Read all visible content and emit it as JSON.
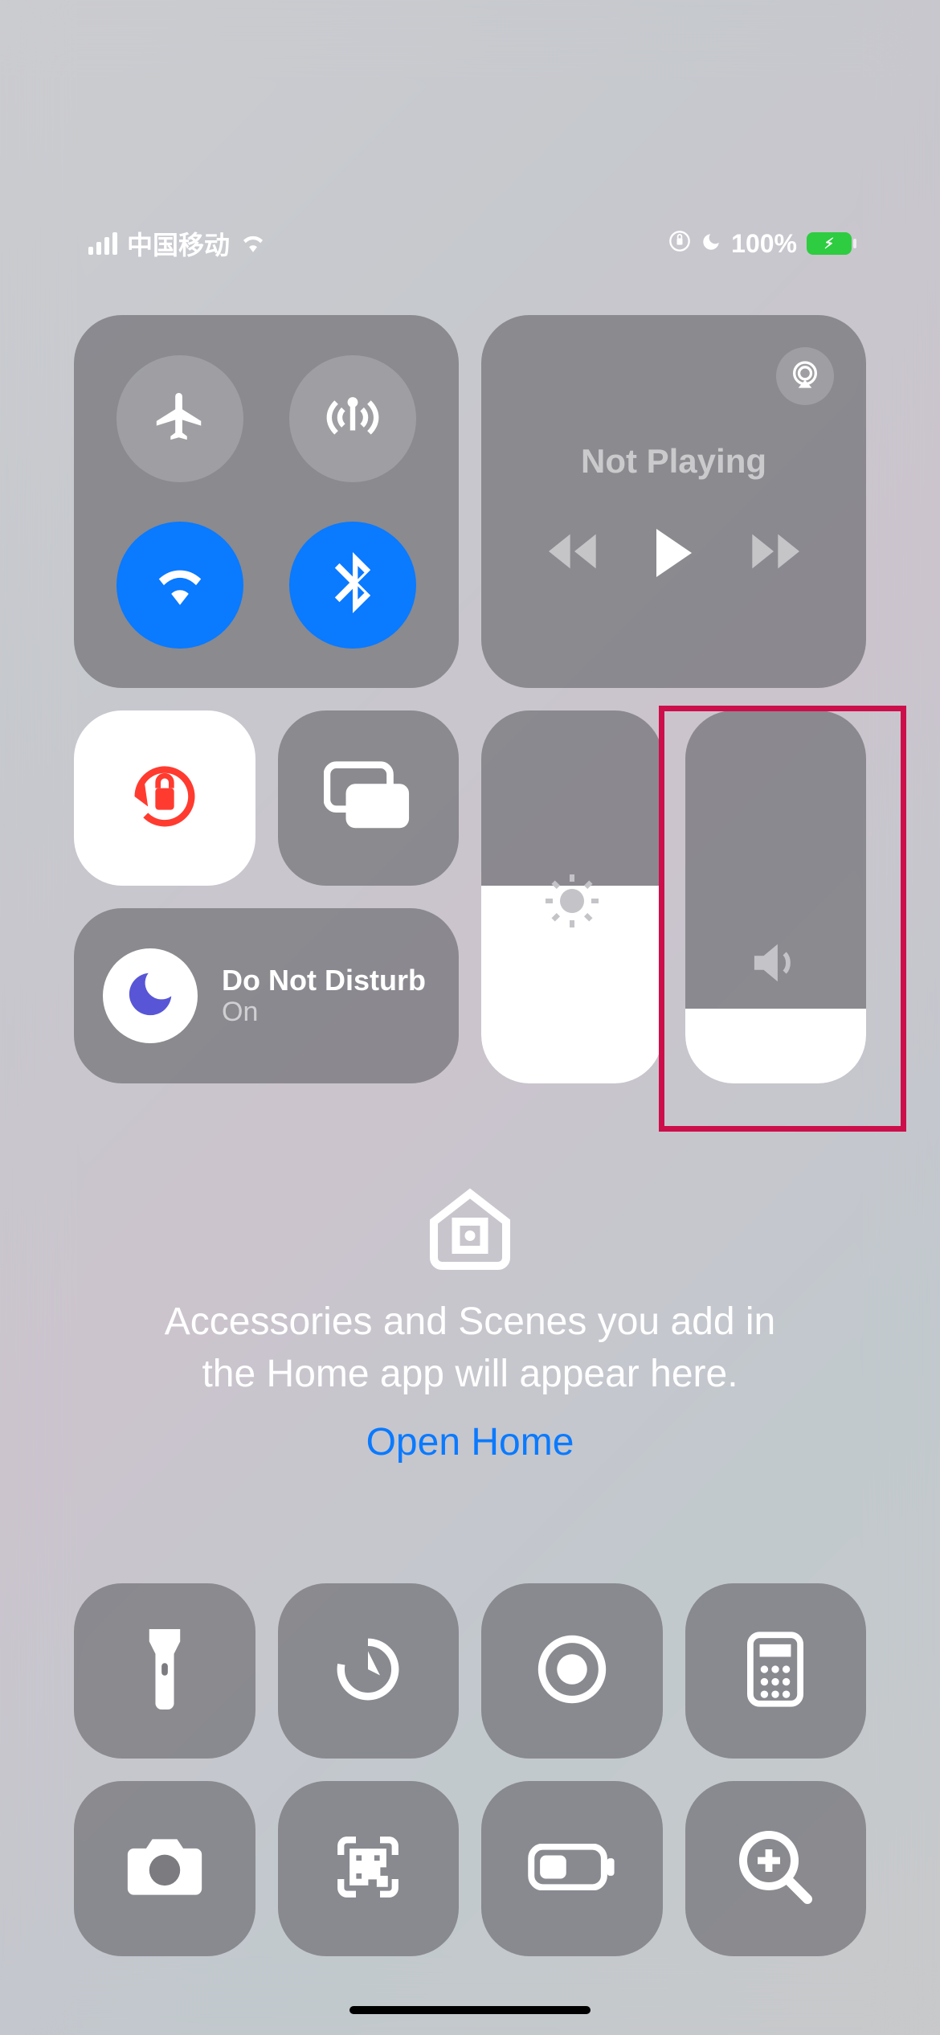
{
  "status": {
    "carrier": "中国移动",
    "battery_percent": "100%"
  },
  "media": {
    "title": "Not Playing"
  },
  "dnd": {
    "title": "Do Not Disturb",
    "state": "On"
  },
  "brightness": {
    "level_percent": 53
  },
  "volume": {
    "level_percent": 20
  },
  "home": {
    "message_line1": "Accessories and Scenes you add in",
    "message_line2": "the Home app will appear here.",
    "link": "Open Home"
  },
  "icons": {
    "airplane": "airplane-icon",
    "cellular": "cellular-data-icon",
    "wifi": "wifi-icon",
    "bluetooth": "bluetooth-icon",
    "airplay": "airplay-icon",
    "orientation_lock": "orientation-lock-icon",
    "screen_mirror": "screen-mirroring-icon",
    "moon": "moon-icon",
    "brightness": "sun-icon",
    "volume": "speaker-icon",
    "home": "home-icon",
    "flashlight": "flashlight-icon",
    "timer": "timer-icon",
    "record": "screen-record-icon",
    "calculator": "calculator-icon",
    "camera": "camera-icon",
    "qr": "qr-scan-icon",
    "low_power": "low-power-icon",
    "magnifier": "magnifier-icon",
    "lock_status": "orientation-lock-status-icon",
    "dnd_status": "moon-status-icon",
    "charging": "charging-bolt-icon"
  },
  "highlight": {
    "target": "volume-slider"
  }
}
